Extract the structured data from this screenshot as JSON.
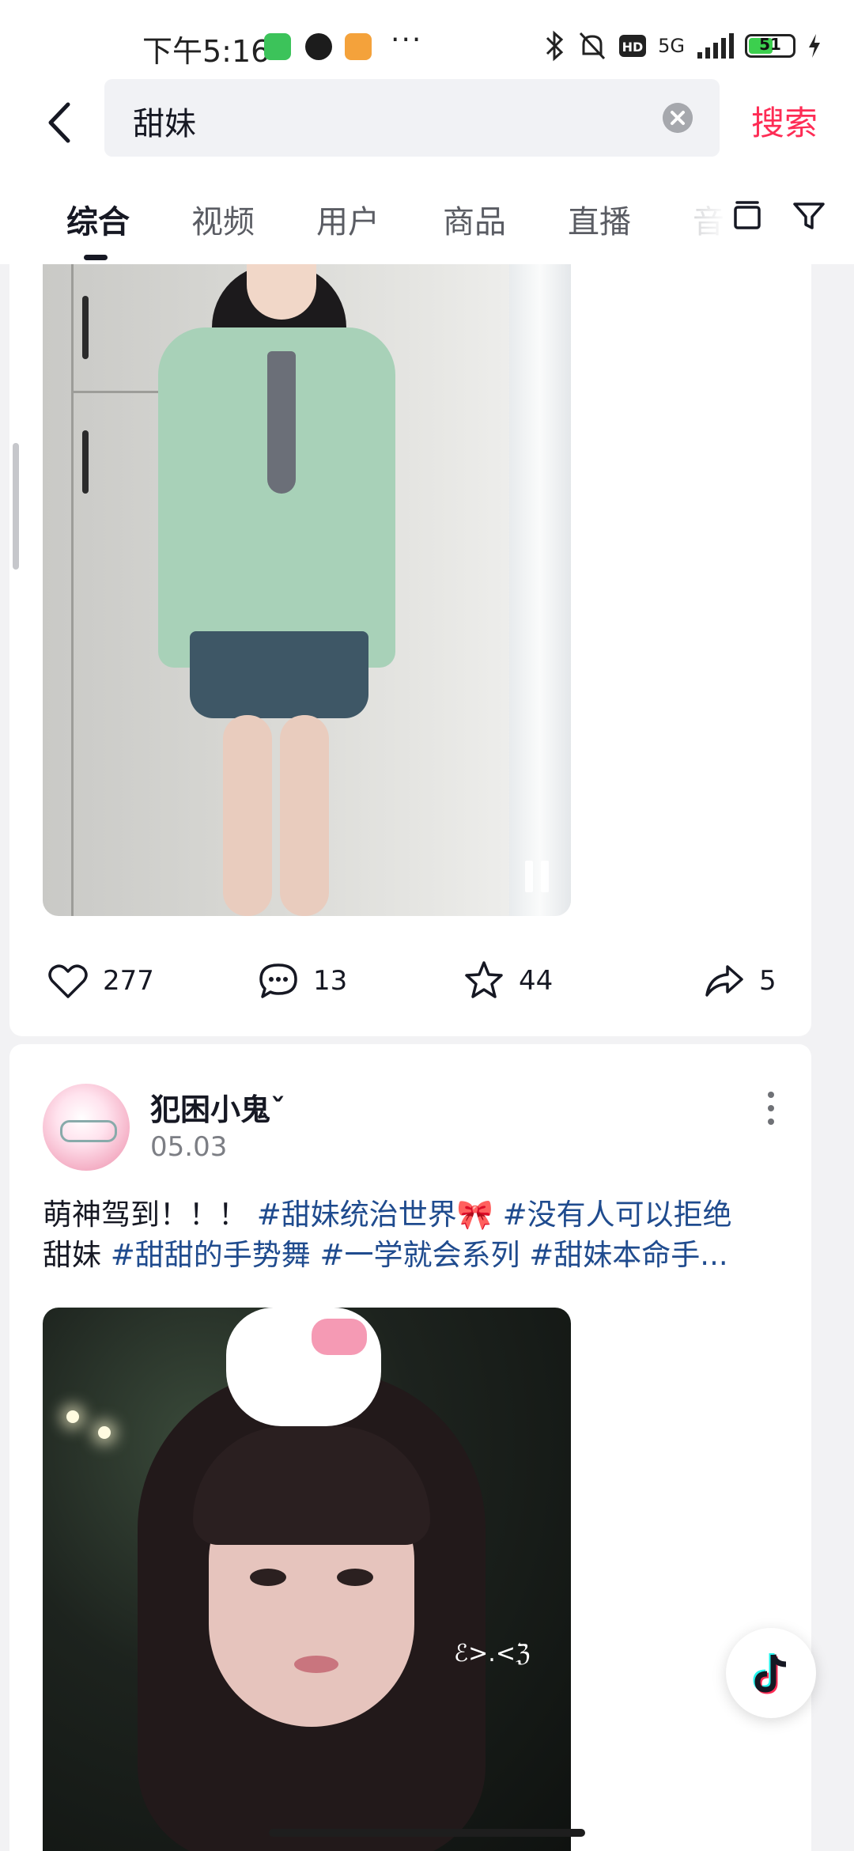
{
  "status_bar": {
    "time": "下午5:16",
    "more_dots": "···",
    "network": "5G",
    "battery": "51",
    "icons": [
      "wechat-app-icon",
      "qq-app-icon",
      "58-app-icon",
      "bluetooth-icon",
      "mute-bell-icon",
      "hd-icon",
      "signal-icon",
      "battery-icon",
      "charging-icon"
    ]
  },
  "search": {
    "query": "甜妹",
    "search_button": "搜索"
  },
  "tabs": [
    {
      "label": "综合",
      "active": true
    },
    {
      "label": "视频",
      "active": false
    },
    {
      "label": "用户",
      "active": false
    },
    {
      "label": "商品",
      "active": false
    },
    {
      "label": "直播",
      "active": false
    },
    {
      "label": "音",
      "active": false
    }
  ],
  "post1": {
    "likes": "277",
    "comments": "13",
    "favorites": "44",
    "shares": "5"
  },
  "post2": {
    "author": "犯困小鬼ˇ",
    "date": "05.03",
    "text_plain_1": "萌神驾到！！！ ",
    "tag_1": "#甜妹统治世界🎀",
    "tag_2": " #没有人可以拒绝",
    "text_plain_2": "甜妹 ",
    "tag_3": "#甜甜的手势舞",
    "tag_4": " #一学就会系列",
    "tag_5": " #甜妹本命手...",
    "image_caption": "ℰ>.<ℨ"
  },
  "colors": {
    "accent": "#fe2c55",
    "hashtag": "#1f4b8e",
    "text": "#161823",
    "muted": "#7c7e84"
  }
}
